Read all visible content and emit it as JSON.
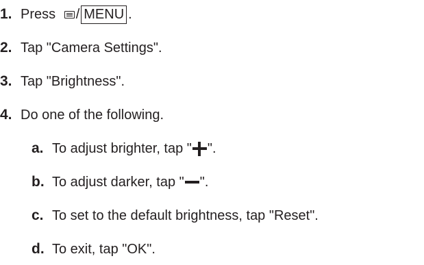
{
  "steps": [
    {
      "number": "1.",
      "pre": "Press ",
      "slash": "/",
      "menu_key": "MENU",
      "post": "."
    },
    {
      "number": "2.",
      "text": "Tap \"Camera Settings\"."
    },
    {
      "number": "3.",
      "text": "Tap \"Brightness\"."
    },
    {
      "number": "4.",
      "text": "Do one of the following."
    }
  ],
  "substeps": [
    {
      "letter": "a.",
      "pre": "To adjust brighter, tap \"",
      "post": "\"."
    },
    {
      "letter": "b.",
      "pre": "To adjust darker, tap \"",
      "post": "\"."
    },
    {
      "letter": "c.",
      "text": "To set to the default brightness, tap \"Reset\"."
    },
    {
      "letter": "d.",
      "text": "To exit, tap \"OK\"."
    }
  ],
  "icons": {
    "menu": "menu-list-icon",
    "plus": "plus-icon",
    "minus": "minus-icon"
  }
}
